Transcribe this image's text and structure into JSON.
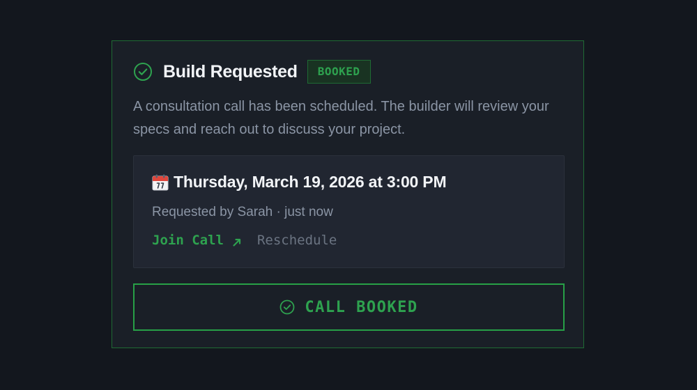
{
  "card": {
    "title": "Build Requested",
    "badge": "BOOKED",
    "description": "A consultation call has been scheduled. The builder will review your specs and reach out to discuss your project.",
    "icon": "check-circle-icon"
  },
  "event": {
    "icon": "calendar-icon",
    "datetime": "Thursday, March 19, 2026 at 3:00 PM",
    "meta": "Requested by Sarah · just now",
    "join_label": "Join Call",
    "join_icon": "arrow-up-right-icon",
    "reschedule_label": "Reschedule"
  },
  "status_button": {
    "label": "CALL BOOKED",
    "icon": "check-circle-icon"
  },
  "colors": {
    "background": "#13171e",
    "card_background": "#1a1f27",
    "card_border": "#1f6b34",
    "accent_green": "#2ea24f",
    "badge_background": "#193322",
    "heading_text": "#f2f4f7",
    "muted_text": "#8b95a5",
    "inner_box_background": "#212631",
    "secondary_link": "#6b7482"
  }
}
